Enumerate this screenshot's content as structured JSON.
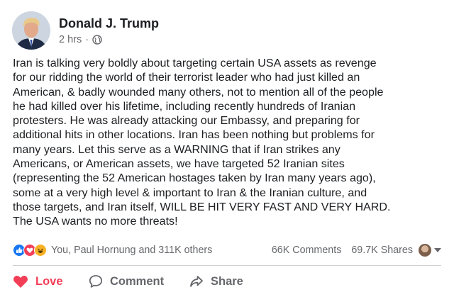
{
  "post": {
    "author": "Donald J. Trump",
    "time": "2 hrs",
    "separator": "·",
    "audience_icon": "globe-icon",
    "text": "Iran is talking very boldly about targeting certain USA assets as revenge\nfor our ridding the world of their terrorist leader who had just killed an\nAmerican, & badly wounded many others, not to mention all of the people\nhe had killed over his lifetime, including recently hundreds of Iranian\nprotesters. He was already attacking our Embassy, and preparing for\nadditional hits in other locations. Iran has been nothing but problems for\nmany years. Let this serve as a WARNING that if Iran strikes any\nAmericans, or American assets, we have targeted 52 Iranian sites\n(representing the 52 American hostages taken by Iran many years ago),\nsome at a very high level & important to Iran &  the Iranian culture, and\nthose targets, and Iran itself, WILL BE HIT VERY FAST AND VERY HARD.\nThe USA wants no more threats!"
  },
  "stats": {
    "reaction_icons": [
      "like-icon",
      "love-icon",
      "haha-icon"
    ],
    "reactors": "You, Paul Hornung and 311K others",
    "comments": "66K Comments",
    "shares": "69.7K Shares"
  },
  "actions": {
    "love_label": "Love",
    "comment_label": "Comment",
    "share_label": "Share"
  },
  "colors": {
    "love": "#f33e58",
    "like": "#1877f2",
    "haha": "#f7b125",
    "secondary_text": "#65676b"
  }
}
